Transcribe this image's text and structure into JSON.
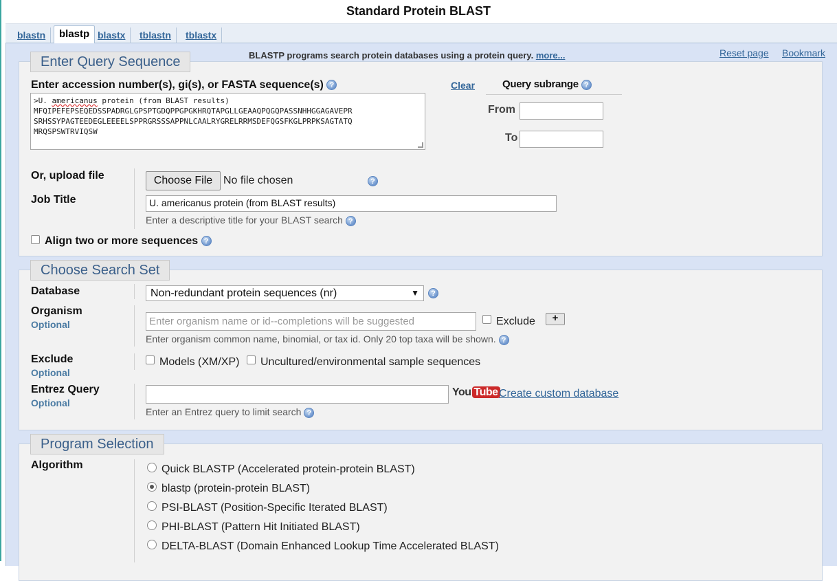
{
  "page": {
    "title": "Standard Protein BLAST"
  },
  "tabs": [
    {
      "label": "blastn"
    },
    {
      "label": "blastp"
    },
    {
      "label": "blastx"
    },
    {
      "label": "tblastn"
    },
    {
      "label": "tblastx"
    }
  ],
  "header": {
    "description": "BLASTP programs search protein databases using a protein query.",
    "more_link": "more...",
    "reset_link": "Reset page",
    "bookmark_link": "Bookmark"
  },
  "query": {
    "legend": "Enter Query Sequence",
    "label": "Enter accession number(s), gi(s), or FASTA sequence(s)",
    "clear_link": "Clear",
    "seq_prefix": ">U. ",
    "seq_underlined": "americanus",
    "seq_rest": " protein (from BLAST results)",
    "seq_line2": "MFQIPEFEPSEQEDSSPADRGLGPSPTGDQPPGPGKHRQTAPGLLGEAAQPQGQPASSNHHGGAGAVEPR",
    "seq_line3": "SRHSSYPAGTEEDEGLEEEELSPPRGRSSSAPPNLCAALRYGRELRRMSDEFQGSFKGLPRPKSAGTATQ",
    "seq_line4": "MRQSPSWTRVIQSW",
    "subrange_title": "Query subrange",
    "from_label": "From",
    "to_label": "To",
    "upload_label": "Or, upload file",
    "choose_file_button": "Choose File",
    "no_file_text": "No file chosen",
    "job_title_label": "Job Title",
    "job_title_value": "U. americanus protein (from BLAST results)",
    "job_title_hint": "Enter a descriptive title for your BLAST search",
    "align_label": "Align two or more sequences"
  },
  "search_set": {
    "legend": "Choose Search Set",
    "database_label": "Database",
    "database_value": "Non-redundant protein sequences (nr)",
    "organism_label": "Organism",
    "optional_label": "Optional",
    "organism_placeholder": "Enter organism name or id--completions will be suggested",
    "exclude_checkbox_label": "Exclude",
    "plus_button": "+",
    "organism_hint": "Enter organism common name, binomial, or tax id. Only 20 top taxa will be shown.",
    "exclude_label": "Exclude",
    "models_label": "Models (XM/XP)",
    "uncultured_label": "Uncultured/environmental sample sequences",
    "entrez_label": "Entrez Query",
    "youtube_you": "You",
    "youtube_tube": "Tube",
    "custom_db_link": "Create custom database",
    "entrez_hint": "Enter an Entrez query to limit search"
  },
  "program": {
    "legend": "Program Selection",
    "algorithm_label": "Algorithm",
    "options": [
      {
        "label": "Quick BLASTP (Accelerated protein-protein BLAST)",
        "selected": false
      },
      {
        "label": "blastp (protein-protein BLAST)",
        "selected": true
      },
      {
        "label": "PSI-BLAST (Position-Specific Iterated BLAST)",
        "selected": false
      },
      {
        "label": "PHI-BLAST (Pattern Hit Initiated BLAST)",
        "selected": false
      },
      {
        "label": "DELTA-BLAST (Domain Enhanced Lookup Time Accelerated BLAST)",
        "selected": false
      }
    ]
  },
  "icons": {
    "help": "question-mark-help-icon",
    "youtube": "youtube-logo"
  },
  "colors": {
    "link": "#336699",
    "legend_text": "#3a5f8a",
    "panel_bg": "#d9e3f5",
    "section_bg": "#f2f2f2"
  }
}
